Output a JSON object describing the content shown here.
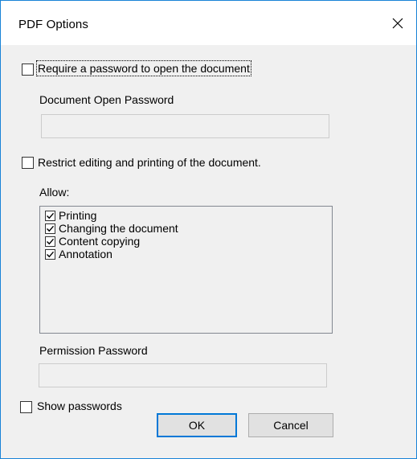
{
  "window": {
    "title": "PDF Options",
    "close_glyph": "✕"
  },
  "require_password": {
    "label": "Require a password to open the document",
    "checked": false
  },
  "open_password": {
    "label": "Document Open Password",
    "value": ""
  },
  "restrict_editing": {
    "label": "Restrict editing and printing of the document.",
    "checked": false
  },
  "allow": {
    "label": "Allow:",
    "items": [
      {
        "label": "Printing",
        "checked": true
      },
      {
        "label": "Changing the document",
        "checked": true
      },
      {
        "label": "Content copying",
        "checked": true
      },
      {
        "label": "Annotation",
        "checked": true
      }
    ]
  },
  "permission_password": {
    "label": "Permission Password",
    "value": ""
  },
  "show_passwords": {
    "label": "Show passwords",
    "checked": false
  },
  "buttons": {
    "ok": "OK",
    "cancel": "Cancel"
  },
  "colors": {
    "accent": "#0078d7",
    "window_border": "#1883d7",
    "dialog_bg": "#f0f0f0"
  }
}
